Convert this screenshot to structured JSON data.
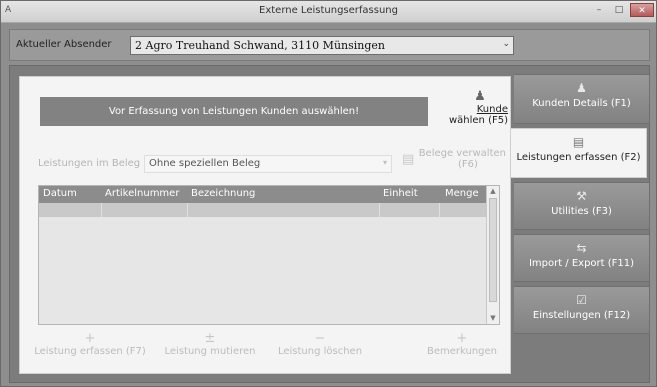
{
  "window": {
    "app_icon": "A",
    "title": "Externe Leistungserfassung",
    "minimize": "–",
    "maximize": "□",
    "close": "✕"
  },
  "sender": {
    "label": "Aktueller Absender",
    "value": "2 Agro Treuhand Schwand, 3110 Münsingen"
  },
  "notice": "Vor Erfassung von Leistungen Kunden auswählen!",
  "kunde_button": {
    "line1": "Kunde",
    "line2": "wählen (F5)",
    "icon": "person-icon"
  },
  "beleg": {
    "label": "Leistungen im Beleg",
    "select_value": "Ohne speziellen Beleg",
    "manage_line1": "Belege verwalten",
    "manage_line2": "(F6)"
  },
  "grid": {
    "columns": [
      "Datum",
      "Artikelnummer",
      "Bezeichnung",
      "Einheit",
      "Menge"
    ]
  },
  "actions": [
    {
      "label": "Leistung erfassen (F7)",
      "icon": "plus-icon"
    },
    {
      "label": "Leistung mutieren",
      "icon": "edit-icon"
    },
    {
      "label": "Leistung löschen",
      "icon": "minus-icon"
    },
    {
      "label": "Bemerkungen",
      "icon": "plus-icon"
    }
  ],
  "tabs": [
    {
      "label": "Kunden Details (F1)",
      "icon": "person-icon"
    },
    {
      "label": "Leistungen erfassen (F2)",
      "icon": "document-icon"
    },
    {
      "label": "Utilities (F3)",
      "icon": "tools-icon"
    },
    {
      "label": "Import / Export (F11)",
      "icon": "transfer-icon"
    },
    {
      "label": "Einstellungen (F12)",
      "icon": "settings-check-icon"
    }
  ]
}
